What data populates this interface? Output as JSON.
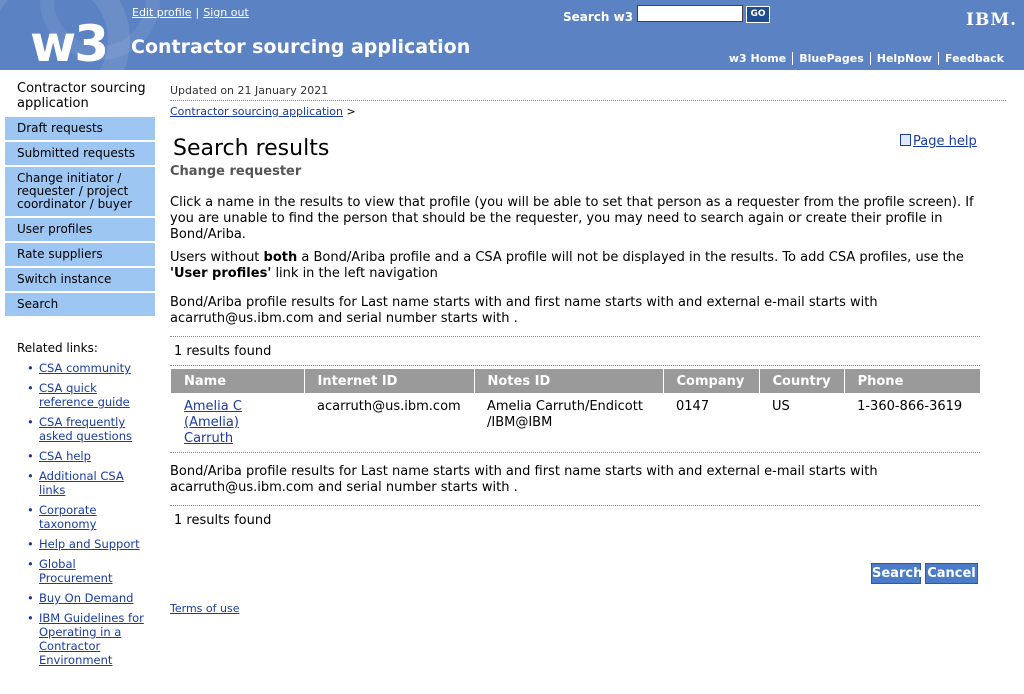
{
  "masthead": {
    "logo": "w3",
    "title": "Contractor sourcing application",
    "edit_profile": "Edit profile",
    "sign_out": "Sign out",
    "search_label": "Search w3",
    "search_value": "",
    "go_label": "GO",
    "ibm_logo": "IBM.",
    "nav": [
      "w3 Home",
      "BluePages",
      "HelpNow",
      "Feedback"
    ]
  },
  "sidebar": {
    "heading": "Contractor sourcing application",
    "items": [
      {
        "label": "Draft requests"
      },
      {
        "label": "Submitted requests"
      },
      {
        "label": "Change initiator / requester / project coordinator / buyer"
      },
      {
        "label": "User profiles"
      },
      {
        "label": "Rate suppliers"
      },
      {
        "label": "Switch instance"
      },
      {
        "label": "Search"
      }
    ],
    "related_label": "Related links:",
    "related_links": [
      "CSA community",
      "CSA quick reference guide",
      "CSA frequently asked questions",
      "CSA help",
      "Additional CSA links",
      "Corporate taxonomy",
      "Help and Support",
      "Global Procurement",
      "Buy On Demand",
      "IBM Guidelines for Operating in a Contractor Environment"
    ]
  },
  "main": {
    "updated": "Updated on 21 January 2021",
    "breadcrumb_link": "Contractor sourcing application",
    "breadcrumb_sep": ">",
    "title": "Search results",
    "subtitle": "Change requester",
    "page_help": "Page help",
    "para1": "Click a name in the results to view that profile (you will be able to set that person as a requester from the profile screen). If you are unable to find the person that should be the requester, you may need to search again or create their profile in Bond/Ariba.",
    "para2_a": "Users without ",
    "para2_b": "both",
    "para2_c": " a Bond/Ariba profile and a CSA profile will not be displayed in the results. To add CSA profiles, use the ",
    "para2_d": "'User profiles'",
    "para2_e": " link in the left navigation",
    "para3": "Bond/Ariba profile results for Last name starts with and first name starts with and external e-mail starts with acarruth@us.ibm.com and serial number starts with .",
    "count1": "1 results found",
    "table": {
      "headers": [
        "Name",
        "Internet ID",
        "Notes ID",
        "Company",
        "Country",
        "Phone"
      ],
      "rows": [
        {
          "name": "Amelia C (Amelia) Carruth",
          "internet_id": "acarruth@us.ibm.com",
          "notes_id": "Amelia Carruth/Endicott /IBM@IBM",
          "company": "0147",
          "country": "US",
          "phone": "1-360-866-3619"
        }
      ]
    },
    "para4": "Bond/Ariba profile results for Last name starts with and first name starts with and external e-mail starts with acarruth@us.ibm.com and serial number starts with .",
    "count2": "1 results found",
    "search_button": "Search",
    "cancel_button": "Cancel",
    "terms": "Terms of use"
  }
}
